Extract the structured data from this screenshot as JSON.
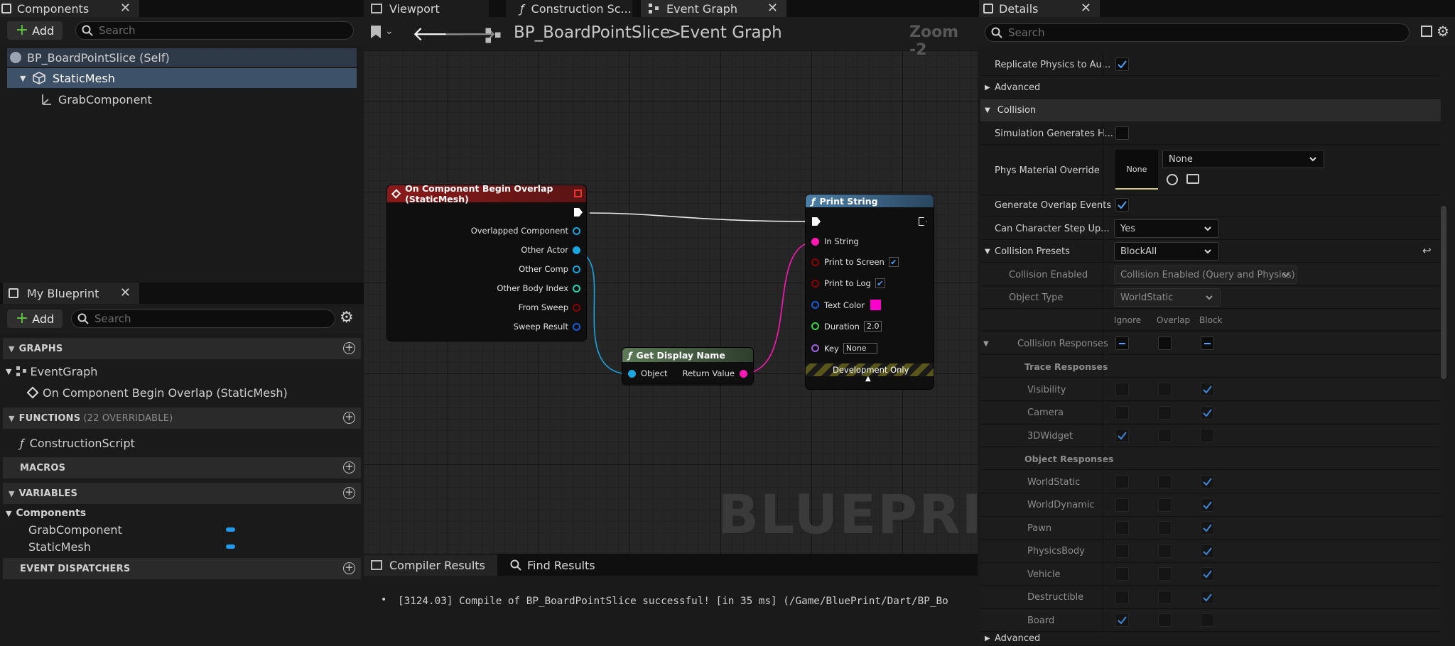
{
  "components_panel": {
    "tab_label": "Components",
    "add_label": "Add",
    "search_placeholder": "Search",
    "tree": [
      {
        "label": "BP_BoardPointSlice (Self)"
      },
      {
        "label": "StaticMesh"
      },
      {
        "label": "GrabComponent"
      }
    ]
  },
  "my_blueprint": {
    "tab_label": "My Blueprint",
    "add_label": "Add",
    "search_placeholder": "Search",
    "graphs_header": "GRAPHS",
    "event_graph": "EventGraph",
    "event_item": "On Component Begin Overlap (StaticMesh)",
    "functions_header": "FUNCTIONS",
    "functions_sub": "(22 OVERRIDABLE)",
    "construction_script": "ConstructionScript",
    "macros_header": "MACROS",
    "variables_header": "VARIABLES",
    "components_category": "Components",
    "variables": [
      "GrabComponent",
      "StaticMesh"
    ],
    "dispatchers_header": "EVENT DISPATCHERS"
  },
  "editor_tabs": {
    "viewport": "Viewport",
    "construction": "Construction Sc...",
    "event_graph": "Event Graph"
  },
  "breadcrumb": {
    "blueprint": "BP_BoardPointSlice",
    "separator": ">",
    "graph": "Event Graph",
    "zoom": "Zoom -2"
  },
  "watermark": "BLUEPRINT",
  "nodes": {
    "event": {
      "title": "On Component Begin Overlap (StaticMesh)",
      "pins": [
        "Overlapped Component",
        "Other Actor",
        "Other Comp",
        "Other Body Index",
        "From Sweep",
        "Sweep Result"
      ]
    },
    "get_display_name": {
      "title": "Get Display Name",
      "in_pin": "Object",
      "out_pin": "Return Value"
    },
    "print_string": {
      "title": "Print String",
      "pins": {
        "in_string": "In String",
        "print_to_screen": "Print to Screen",
        "print_to_log": "Print to Log",
        "text_color": "Text Color",
        "duration": "Duration",
        "duration_value": "2.0",
        "key": "Key",
        "key_value": "None"
      },
      "footer": "Development Only",
      "text_color_swatch": "#ff00cc"
    }
  },
  "compiler": {
    "tab_results": "Compiler Results",
    "tab_find": "Find Results",
    "message": "[3124.03] Compile of BP_BoardPointSlice successful! [in 35 ms] (/Game/BluePrint/Dart/BP_Bo"
  },
  "details": {
    "tab_label": "Details",
    "search_placeholder": "Search",
    "rows": {
      "replicate": "Replicate Physics to Au...",
      "advanced": "Advanced",
      "collision": "Collision",
      "sim_hit": "Simulation Generates H...",
      "phys_material": "Phys Material Override",
      "phys_thumb": "None",
      "phys_combo": "None",
      "overlap_events": "Generate Overlap Events",
      "step_up": "Can Character Step Up...",
      "step_up_value": "Yes",
      "presets": "Collision Presets",
      "presets_value": "BlockAll",
      "enabled": "Collision Enabled",
      "enabled_value": "Collision Enabled (Query and Physics)",
      "object_type": "Object Type",
      "object_type_value": "WorldStatic",
      "col_ignore": "Ignore",
      "col_overlap": "Overlap",
      "col_block": "Block",
      "responses": "Collision Responses",
      "trace_responses": "Trace Responses",
      "object_responses": "Object Responses",
      "advanced_bottom": "Advanced"
    },
    "trace_channels": [
      {
        "name": "Visibility",
        "value": "Block"
      },
      {
        "name": "Camera",
        "value": "Block"
      },
      {
        "name": "3DWidget",
        "value": "Ignore"
      }
    ],
    "object_channels": [
      {
        "name": "WorldStatic",
        "value": "Block"
      },
      {
        "name": "WorldDynamic",
        "value": "Block"
      },
      {
        "name": "Pawn",
        "value": "Block"
      },
      {
        "name": "PhysicsBody",
        "value": "Block"
      },
      {
        "name": "Vehicle",
        "value": "Block"
      },
      {
        "name": "Destructible",
        "value": "Block"
      },
      {
        "name": "Board",
        "value": "Ignore"
      }
    ]
  }
}
